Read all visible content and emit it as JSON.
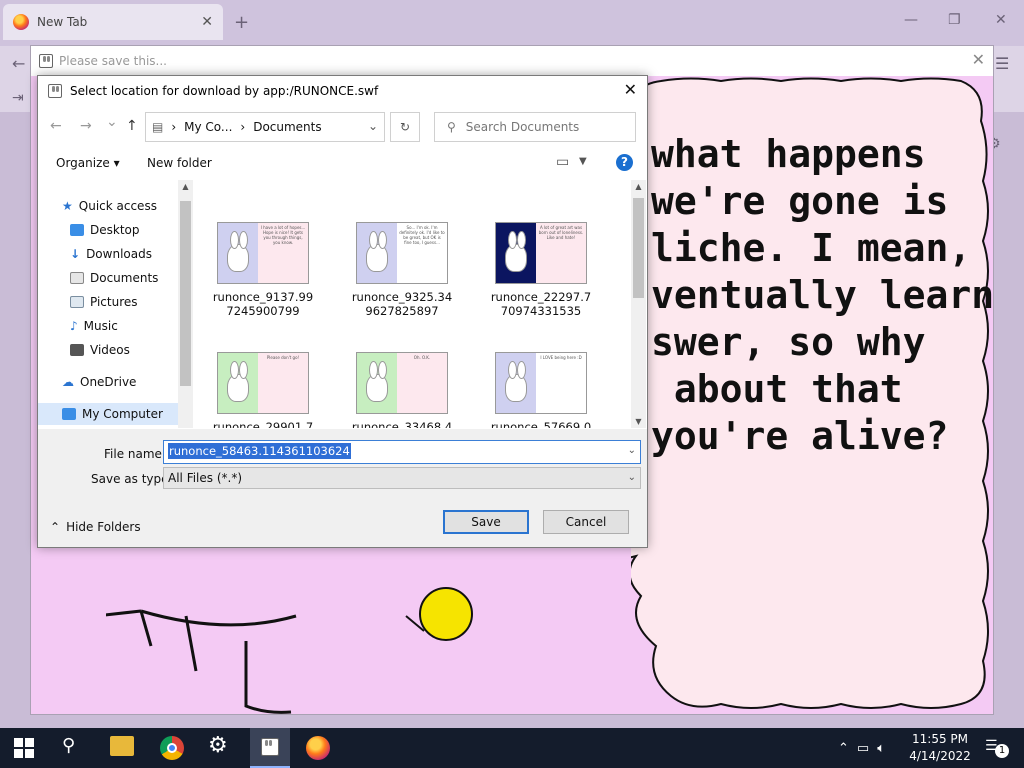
{
  "browser": {
    "tab_title": "New Tab",
    "tab_close": "✕",
    "new_tab": "+",
    "minimize": "—",
    "restore": "❐",
    "close": "✕",
    "back": "←",
    "menu": "☰"
  },
  "outer_window": {
    "title": "Please save this...",
    "close": "✕"
  },
  "comic": {
    "text": "what happens\nwe're gone is\nliche. I mean,\nventually learn\nswer, so why\n about that\nyou're alive?"
  },
  "dialog": {
    "title": "Select location for download by app:/RUNONCE.swf",
    "close": "✕",
    "back": "←",
    "forward": "→",
    "recent": "⌄",
    "up": "↑",
    "breadcrumb": [
      "My Co...",
      "Documents"
    ],
    "search_placeholder": "Search Documents",
    "organize": "Organize",
    "new_folder": "New folder",
    "help": "?",
    "nav_items": [
      {
        "label": "Quick access"
      },
      {
        "label": "Desktop"
      },
      {
        "label": "Downloads"
      },
      {
        "label": "Documents"
      },
      {
        "label": "Pictures"
      },
      {
        "label": "Music"
      },
      {
        "label": "Videos"
      },
      {
        "label": "OneDrive"
      },
      {
        "label": "My Computer"
      }
    ],
    "files": [
      {
        "name": "runonce_9137.99\n7245900799",
        "panel_text": "I have a lot of hopes... Hope is nice! It gets you through things, you know."
      },
      {
        "name": "runonce_9325.34\n9627825897",
        "panel_text": "So... I'm ok. I'm definitely ok. I'd like to be great, but OK is fine too, I guess..."
      },
      {
        "name": "runonce_22297.7\n70974331535",
        "panel_text": "A lot of great art was born out of loneliness. Like and hate!"
      },
      {
        "name": "runonce_29901.7",
        "panel_text": "Please don't go!"
      },
      {
        "name": "runonce_33468.4",
        "panel_text": "Oh. O.K."
      },
      {
        "name": "runonce_57669.0",
        "panel_text": "I LOVE being here :D"
      }
    ],
    "file_name_label": "File name:",
    "file_name_value": "runonce_58463.114361103624",
    "save_type_label": "Save as type:",
    "save_type_value": "All Files (*.*)",
    "hide_folders": "Hide Folders",
    "save": "Save",
    "cancel": "Cancel"
  },
  "taskbar": {
    "time": "11:55 PM",
    "date": "4/14/2022",
    "notification_count": "1",
    "search": "⚲",
    "settings": "⚙"
  },
  "colors": {
    "flash_bg": "#f4caf4",
    "bubble": "#fde8ee",
    "selection": "#2f6fd6",
    "taskbar": "#141c2c"
  }
}
